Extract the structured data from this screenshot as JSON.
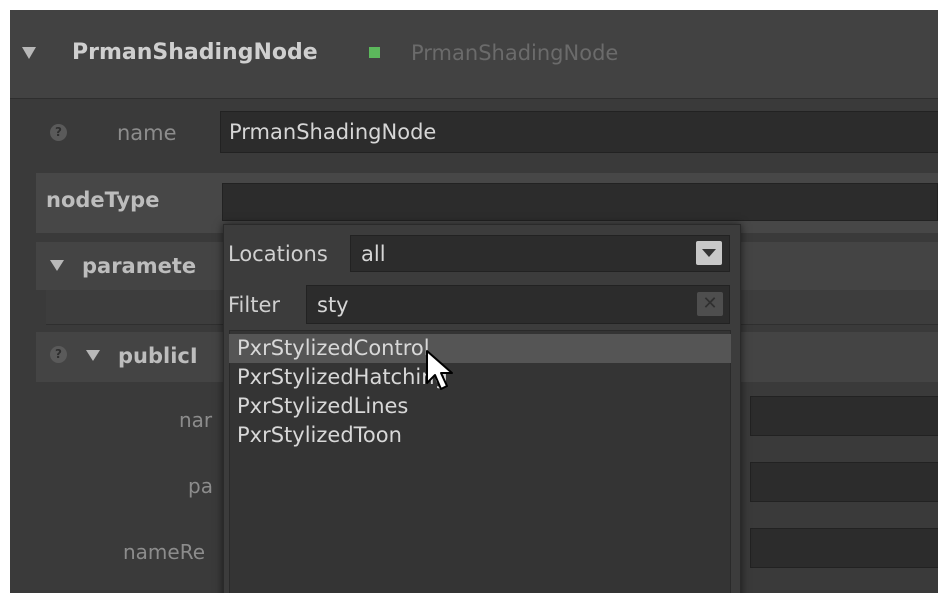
{
  "header": {
    "title": "PrmanShadingNode",
    "subtitle": "PrmanShadingNode",
    "status_color": "#5cb85c"
  },
  "name_row": {
    "label": "name",
    "value": "PrmanShadingNode",
    "help_icon": "question-icon"
  },
  "nodetype_row": {
    "label": "nodeType",
    "value": ""
  },
  "parameters_section": {
    "label": "paramete"
  },
  "public_section": {
    "label": "publicI",
    "fields": [
      "nar",
      "pa",
      "nameRe"
    ]
  },
  "popup": {
    "locations_label": "Locations",
    "locations_value": "all",
    "filter_label": "Filter",
    "filter_value": "sty",
    "results": [
      "PxrStylizedControl",
      "PxrStylizedHatching",
      "PxrStylizedLines",
      "PxrStylizedToon"
    ],
    "selected_index": 0
  }
}
